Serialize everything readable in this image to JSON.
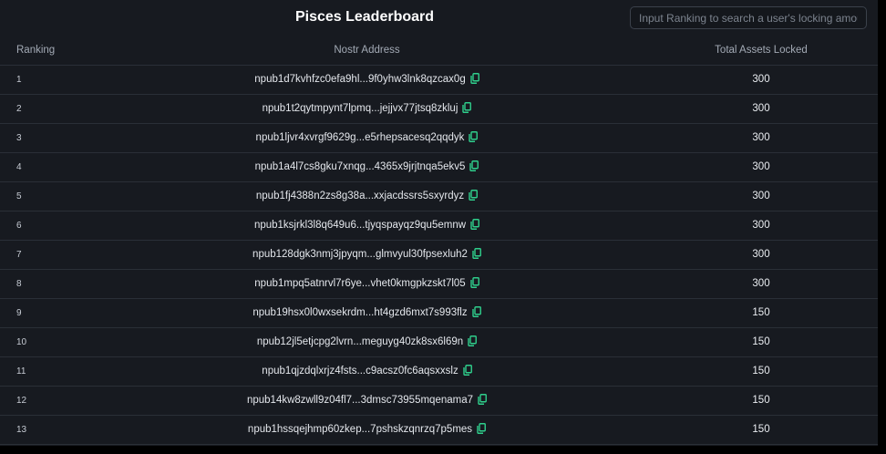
{
  "header": {
    "title": "Pisces Leaderboard",
    "search_placeholder": "Input Ranking to search a user's locking amou..."
  },
  "table": {
    "columns": {
      "ranking": "Ranking",
      "address": "Nostr Address",
      "total": "Total Assets Locked"
    },
    "rows": [
      {
        "rank": "1",
        "address": "npub1d7kvhfzc0efa9hl...9f0yhw3lnk8qzcax0g",
        "total": "300"
      },
      {
        "rank": "2",
        "address": "npub1t2qytmpynt7lpmq...jejjvx77jtsq8zkluj",
        "total": "300"
      },
      {
        "rank": "3",
        "address": "npub1ljvr4xvrgf9629g...e5rhepsacesq2qqdyk",
        "total": "300"
      },
      {
        "rank": "4",
        "address": "npub1a4l7cs8gku7xnqg...4365x9jrjtnqa5ekv5",
        "total": "300"
      },
      {
        "rank": "5",
        "address": "npub1fj4388n2zs8g38a...xxjacdssrs5sxyrdyz",
        "total": "300"
      },
      {
        "rank": "6",
        "address": "npub1ksjrkl3l8q649u6...tjyqspayqz9qu5emnw",
        "total": "300"
      },
      {
        "rank": "7",
        "address": "npub128dgk3nmj3jpyqm...glmvyul30fpsexluh2",
        "total": "300"
      },
      {
        "rank": "8",
        "address": "npub1mpq5atnrvl7r6ye...vhet0kmgpkzskt7l05",
        "total": "300"
      },
      {
        "rank": "9",
        "address": "npub19hsx0l0wxsekrdm...ht4gzd6mxt7s993flz",
        "total": "150"
      },
      {
        "rank": "10",
        "address": "npub12jl5etjcpg2lvrn...meguyg40zk8sx6l69n",
        "total": "150"
      },
      {
        "rank": "11",
        "address": "npub1qjzdqlxrjz4fsts...c9acsz0fc6aqsxxslz",
        "total": "150"
      },
      {
        "rank": "12",
        "address": "npub14kw8zwll9z04fl7...3dmsc73955mqenama7",
        "total": "150"
      },
      {
        "rank": "13",
        "address": "npub1hssqejhmp60zkep...7pshskzqnrzq7p5mes",
        "total": "150"
      }
    ]
  },
  "icons": {
    "copy": "copy-icon"
  },
  "colors": {
    "background": "#171a20",
    "accent_copy": "#2fcf8c",
    "divider": "#2a2f37"
  }
}
